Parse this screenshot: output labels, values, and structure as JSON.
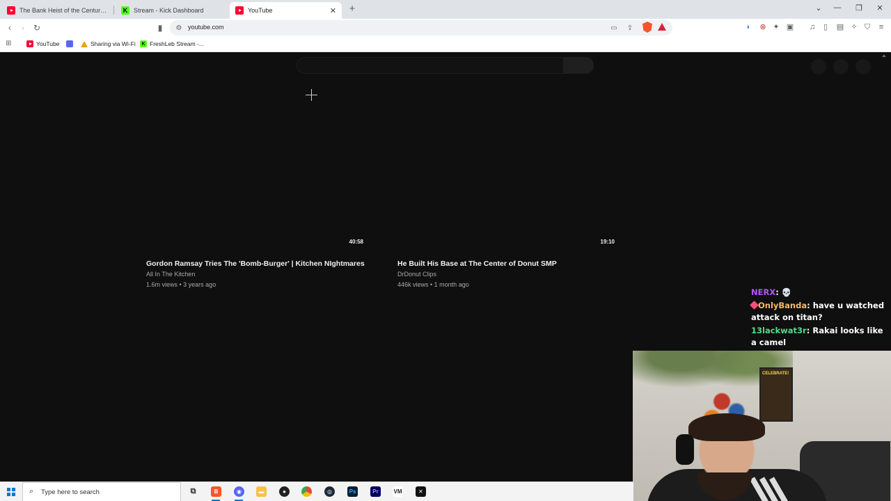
{
  "browser": {
    "tabs": [
      {
        "title": "The Bank Heist of the Century - YouT",
        "favicon": "youtube-icon",
        "active": false
      },
      {
        "title": "Stream - Kick Dashboard",
        "favicon": "kick-icon",
        "active": false
      },
      {
        "title": "YouTube",
        "favicon": "youtube-icon",
        "active": true
      }
    ],
    "new_tab_label": "+",
    "address": "youtube.com",
    "bookmarks": [
      {
        "label": "YouTube",
        "icon": "youtube-icon"
      },
      {
        "label": "",
        "icon": "discord-icon"
      },
      {
        "label": "Sharing via Wi-Fi",
        "icon": "warning-icon"
      },
      {
        "label": "FreshLeb Stream -...",
        "icon": "kick-icon"
      }
    ]
  },
  "youtube": {
    "videos": [
      {
        "duration": "40:58",
        "title": "Gordon Ramsay Tries The 'Bomb-Burger' | Kitchen NIghtmares",
        "channel": "All In The Kitchen",
        "meta": "1.6m views • 3 years ago"
      },
      {
        "duration": "19:10",
        "title": "He Built His Base at The Center of Donut SMP",
        "channel": "DrDonut Clips",
        "meta": "446k views • 1 month ago"
      }
    ]
  },
  "chat": {
    "messages": [
      {
        "user": "NERX",
        "text": " 💀",
        "color": "#b455ff"
      },
      {
        "user": "OnlyBanda",
        "text": " have u watched attack on titan?",
        "color": "#f5b96b"
      },
      {
        "user": "13lackwat3r",
        "text": " Rakai looks like a camel",
        "color": "#4fdc8c"
      }
    ]
  },
  "webcam": {
    "poster_text": "CELEBRATE!"
  },
  "taskbar": {
    "search_placeholder": "Type here to search",
    "apps": [
      "task-view-icon",
      "brave-icon",
      "discord-icon",
      "file-explorer-icon",
      "obs-icon",
      "chrome-icon",
      "steam-icon",
      "photoshop-icon",
      "premiere-icon",
      "vmware-icon",
      "capcut-icon"
    ]
  },
  "colors": {
    "youtube_red": "#ff0033",
    "kick_green": "#53fc18",
    "page_bg": "#0f0f0f"
  }
}
